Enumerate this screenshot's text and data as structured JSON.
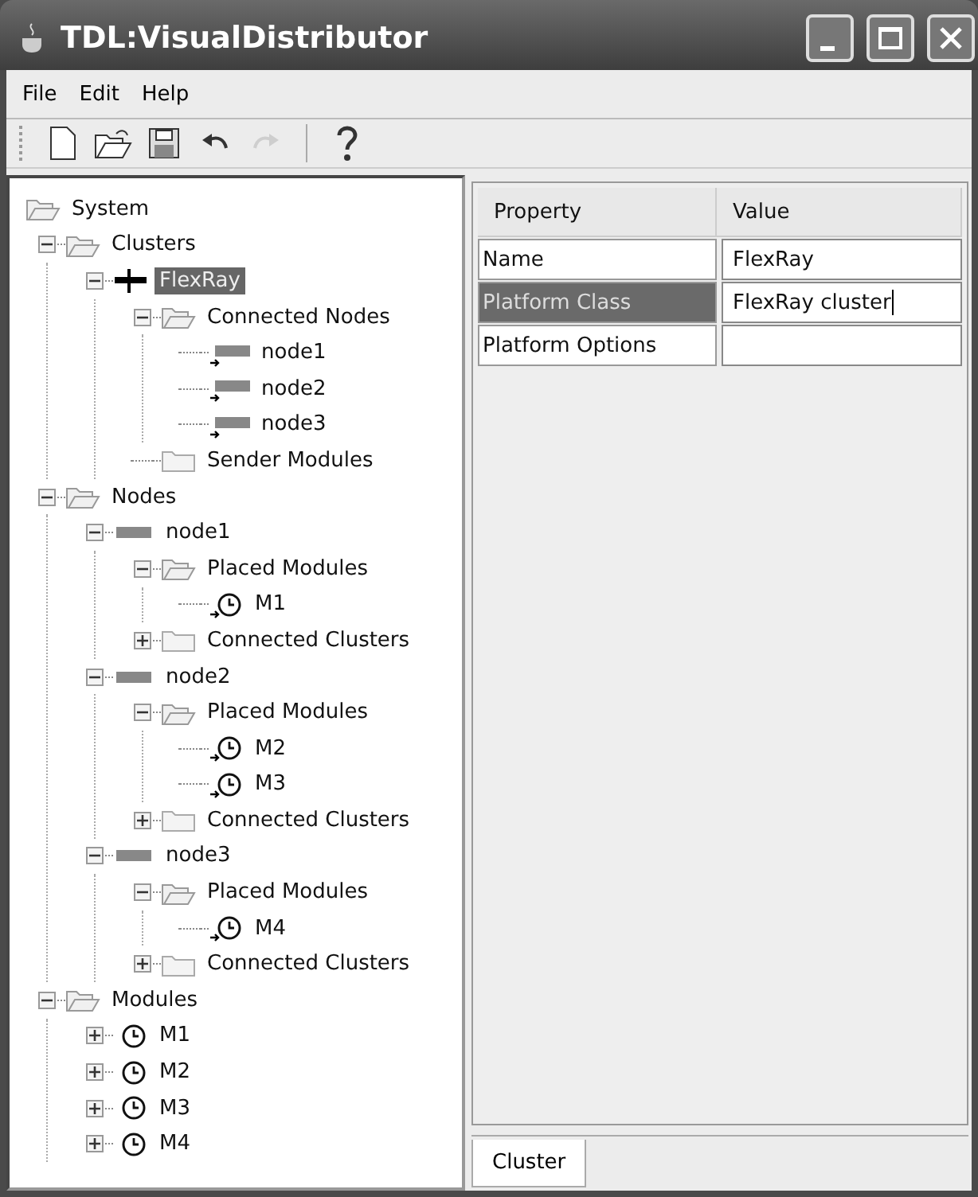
{
  "window": {
    "title": "TDL:VisualDistributor"
  },
  "menu": [
    "File",
    "Edit",
    "Help"
  ],
  "toolbar": [
    {
      "items": [
        {
          "kind": "new",
          "disabled": false
        },
        {
          "kind": "open",
          "disabled": false
        },
        {
          "kind": "save",
          "disabled": false
        },
        {
          "kind": "undo",
          "disabled": false
        },
        {
          "kind": "redo",
          "disabled": true
        }
      ]
    },
    {
      "items": [
        {
          "kind": "help",
          "disabled": false
        }
      ]
    }
  ],
  "tree": {
    "label": "System",
    "kind": "folder",
    "selected": false,
    "expanded": true,
    "children": [
      {
        "label": "Clusters",
        "kind": "folder",
        "selected": false,
        "expanded": true,
        "children": [
          {
            "label": "FlexRay",
            "kind": "bus",
            "selected": true,
            "expanded": true,
            "children": [
              {
                "label": "Connected Nodes",
                "kind": "folder",
                "selected": false,
                "expanded": true,
                "children": [
                  {
                    "label": "node1",
                    "kind": "noderef",
                    "selected": false
                  },
                  {
                    "label": "node2",
                    "kind": "noderef",
                    "selected": false
                  },
                  {
                    "label": "node3",
                    "kind": "noderef",
                    "selected": false
                  }
                ]
              },
              {
                "label": "Sender Modules",
                "kind": "folder",
                "selected": false
              }
            ]
          }
        ]
      },
      {
        "label": "Nodes",
        "kind": "folder",
        "selected": false,
        "expanded": true,
        "children": [
          {
            "label": "node1",
            "kind": "node",
            "selected": false,
            "expanded": true,
            "children": [
              {
                "label": "Placed Modules",
                "kind": "folder",
                "selected": false,
                "expanded": true,
                "children": [
                  {
                    "label": "M1",
                    "kind": "moduleref",
                    "selected": false
                  }
                ]
              },
              {
                "label": "Connected Clusters",
                "kind": "folder",
                "selected": false,
                "expanded": false
              }
            ]
          },
          {
            "label": "node2",
            "kind": "node",
            "selected": false,
            "expanded": true,
            "children": [
              {
                "label": "Placed Modules",
                "kind": "folder",
                "selected": false,
                "expanded": true,
                "children": [
                  {
                    "label": "M2",
                    "kind": "moduleref",
                    "selected": false
                  },
                  {
                    "label": "M3",
                    "kind": "moduleref",
                    "selected": false
                  }
                ]
              },
              {
                "label": "Connected Clusters",
                "kind": "folder",
                "selected": false,
                "expanded": false
              }
            ]
          },
          {
            "label": "node3",
            "kind": "node",
            "selected": false,
            "expanded": true,
            "children": [
              {
                "label": "Placed Modules",
                "kind": "folder",
                "selected": false,
                "expanded": true,
                "children": [
                  {
                    "label": "M4",
                    "kind": "moduleref",
                    "selected": false
                  }
                ]
              },
              {
                "label": "Connected Clusters",
                "kind": "folder",
                "selected": false,
                "expanded": false
              }
            ]
          }
        ]
      },
      {
        "label": "Modules",
        "kind": "folder",
        "selected": false,
        "expanded": true,
        "children": [
          {
            "label": "M1",
            "kind": "module",
            "selected": false,
            "expanded": false
          },
          {
            "label": "M2",
            "kind": "module",
            "selected": false,
            "expanded": false
          },
          {
            "label": "M3",
            "kind": "module",
            "selected": false,
            "expanded": false
          },
          {
            "label": "M4",
            "kind": "module",
            "selected": false,
            "expanded": false
          }
        ]
      }
    ]
  },
  "properties": {
    "columns": [
      "Property",
      "Value"
    ],
    "rows": [
      {
        "name": "Name",
        "value": "FlexRay",
        "selected": false,
        "editing": false
      },
      {
        "name": "Platform Class",
        "value": "FlexRay cluster",
        "selected": true,
        "editing": true
      },
      {
        "name": "Platform Options",
        "value": "",
        "selected": false,
        "editing": false
      }
    ]
  },
  "tabs": [
    {
      "label": "Cluster",
      "selected": true
    }
  ]
}
